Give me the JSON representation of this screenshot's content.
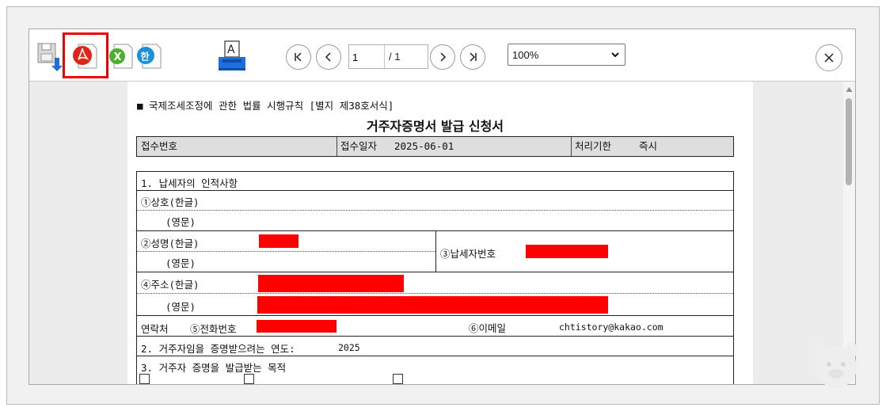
{
  "toolbar": {
    "icons": [
      "save-icon",
      "pdf-icon",
      "excel-icon",
      "hwp-icon",
      "print-icon"
    ],
    "page_current": "1",
    "page_total": "/ 1",
    "zoom": "100%",
    "highlight_color": "#ee0000"
  },
  "document": {
    "form_ref": "■ 국제조세조정에 관한 법률 시행규칙 [별지 제38호서식]",
    "title": "거주자증명서 발급 신청서",
    "receipt": {
      "no_label": "접수번호",
      "date_label": "접수일자",
      "date_value": "2025-06-01",
      "deadline_label": "처리기한",
      "deadline_value": "즉시"
    },
    "section1": {
      "heading": "1. 납세자의 인적사항",
      "company_ko": "①상호(한글)",
      "company_en": "(영문)",
      "name_ko": "②성명(한글)",
      "name_en": "(영문)",
      "taxpayer_no": "③납세자번호",
      "address_ko": "④주소(한글)",
      "address_en": "(영문)",
      "contact": "연락처",
      "phone": "⑤전화번호",
      "email_label": "⑥이메일",
      "email_value": "chtistory@kakao.com"
    },
    "section2": {
      "heading": "2. 거주자임을 증명받으려는 연도:",
      "year": "2025"
    },
    "section3": {
      "heading": "3. 거주자 증명을 발급받는 목적"
    },
    "redact_color": "#ff0000"
  }
}
